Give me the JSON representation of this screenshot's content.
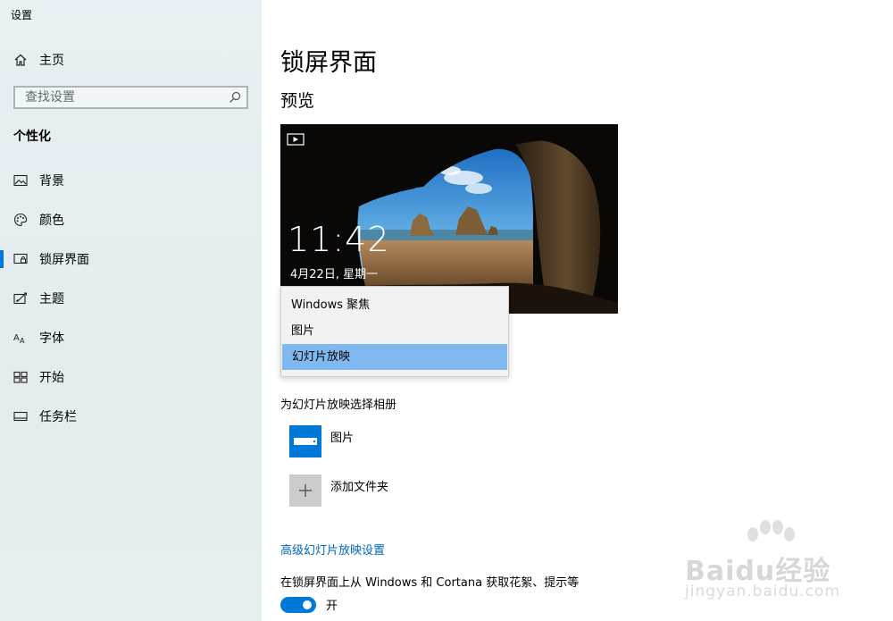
{
  "app": {
    "title": "设置"
  },
  "sidebar": {
    "home_label": "主页",
    "search_placeholder": "查找设置",
    "section_title": "个性化",
    "items": [
      {
        "label": "背景",
        "icon": "picture-icon"
      },
      {
        "label": "颜色",
        "icon": "palette-icon"
      },
      {
        "label": "锁屏界面",
        "icon": "lock-screen-icon",
        "active": true
      },
      {
        "label": "主题",
        "icon": "theme-icon"
      },
      {
        "label": "字体",
        "icon": "font-icon"
      },
      {
        "label": "开始",
        "icon": "start-icon"
      },
      {
        "label": "任务栏",
        "icon": "taskbar-icon"
      }
    ]
  },
  "main": {
    "page_title": "锁屏界面",
    "preview_heading": "预览",
    "preview": {
      "time": "11:42",
      "date": "4月22日, 星期一"
    },
    "background_dropdown": {
      "options": [
        "Windows 聚焦",
        "图片",
        "幻灯片放映"
      ],
      "selected": "幻灯片放映"
    },
    "album_label": "为幻灯片放映选择相册",
    "albums": [
      {
        "label": "图片",
        "icon": "folder-icon"
      },
      {
        "label": "添加文件夹",
        "icon": "plus-icon"
      }
    ],
    "advanced_link": "高级幻灯片放映设置",
    "fun_facts_label": "在锁屏界面上从 Windows 和 Cortana 获取花絮、提示等",
    "toggle_state": "开",
    "toggle_on": true
  },
  "watermark": {
    "brand": "Baidu经验",
    "url": "jingyan.baidu.com"
  },
  "colors": {
    "accent": "#0078d7",
    "link": "#0067c0",
    "selected_option": "#7fb9ef"
  }
}
